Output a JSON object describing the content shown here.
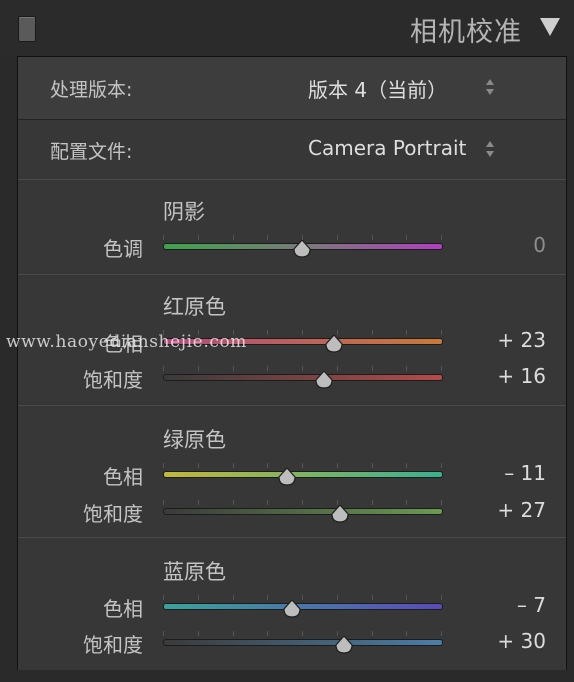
{
  "panel": {
    "title": "相机校准"
  },
  "process": {
    "label": "处理版本:",
    "value": "版本 4（当前）"
  },
  "profile": {
    "label": "配置文件:",
    "value": "Camera Portrait"
  },
  "shadows": {
    "title": "阴影",
    "tint": {
      "label": "色调",
      "value_text": "0",
      "value": 0
    }
  },
  "red": {
    "title": "红原色",
    "hue": {
      "label": "色相",
      "value_text": "+ 23",
      "value": 23
    },
    "saturation": {
      "label": "饱和度",
      "value_text": "+ 16",
      "value": 16
    }
  },
  "green": {
    "title": "绿原色",
    "hue": {
      "label": "色相",
      "value_text": "– 11",
      "value": -11
    },
    "saturation": {
      "label": "饱和度",
      "value_text": "+ 27",
      "value": 27
    }
  },
  "blue": {
    "title": "蓝原色",
    "hue": {
      "label": "色相",
      "value_text": "– 7",
      "value": -7
    },
    "saturation": {
      "label": "饱和度",
      "value_text": "+ 30",
      "value": 30
    }
  },
  "watermark": {
    "text": "www.haoyedianshejie.com"
  },
  "colors": {
    "panel_bg": "#373737",
    "thumb": "#bdbdbd",
    "tint_left": "#3fa34d",
    "tint_right": "#b03fbf",
    "red_hue_left": "#b04a7a",
    "red_hue_right": "#c77a3a",
    "red_sat": "#b64a4a",
    "green_hue_left": "#c2b83a",
    "green_hue_right": "#3ab08f",
    "green_sat": "#6a9a52",
    "blue_hue_left": "#3aa39b",
    "blue_hue_right": "#5a4ab8",
    "blue_sat": "#4a7ea8"
  }
}
